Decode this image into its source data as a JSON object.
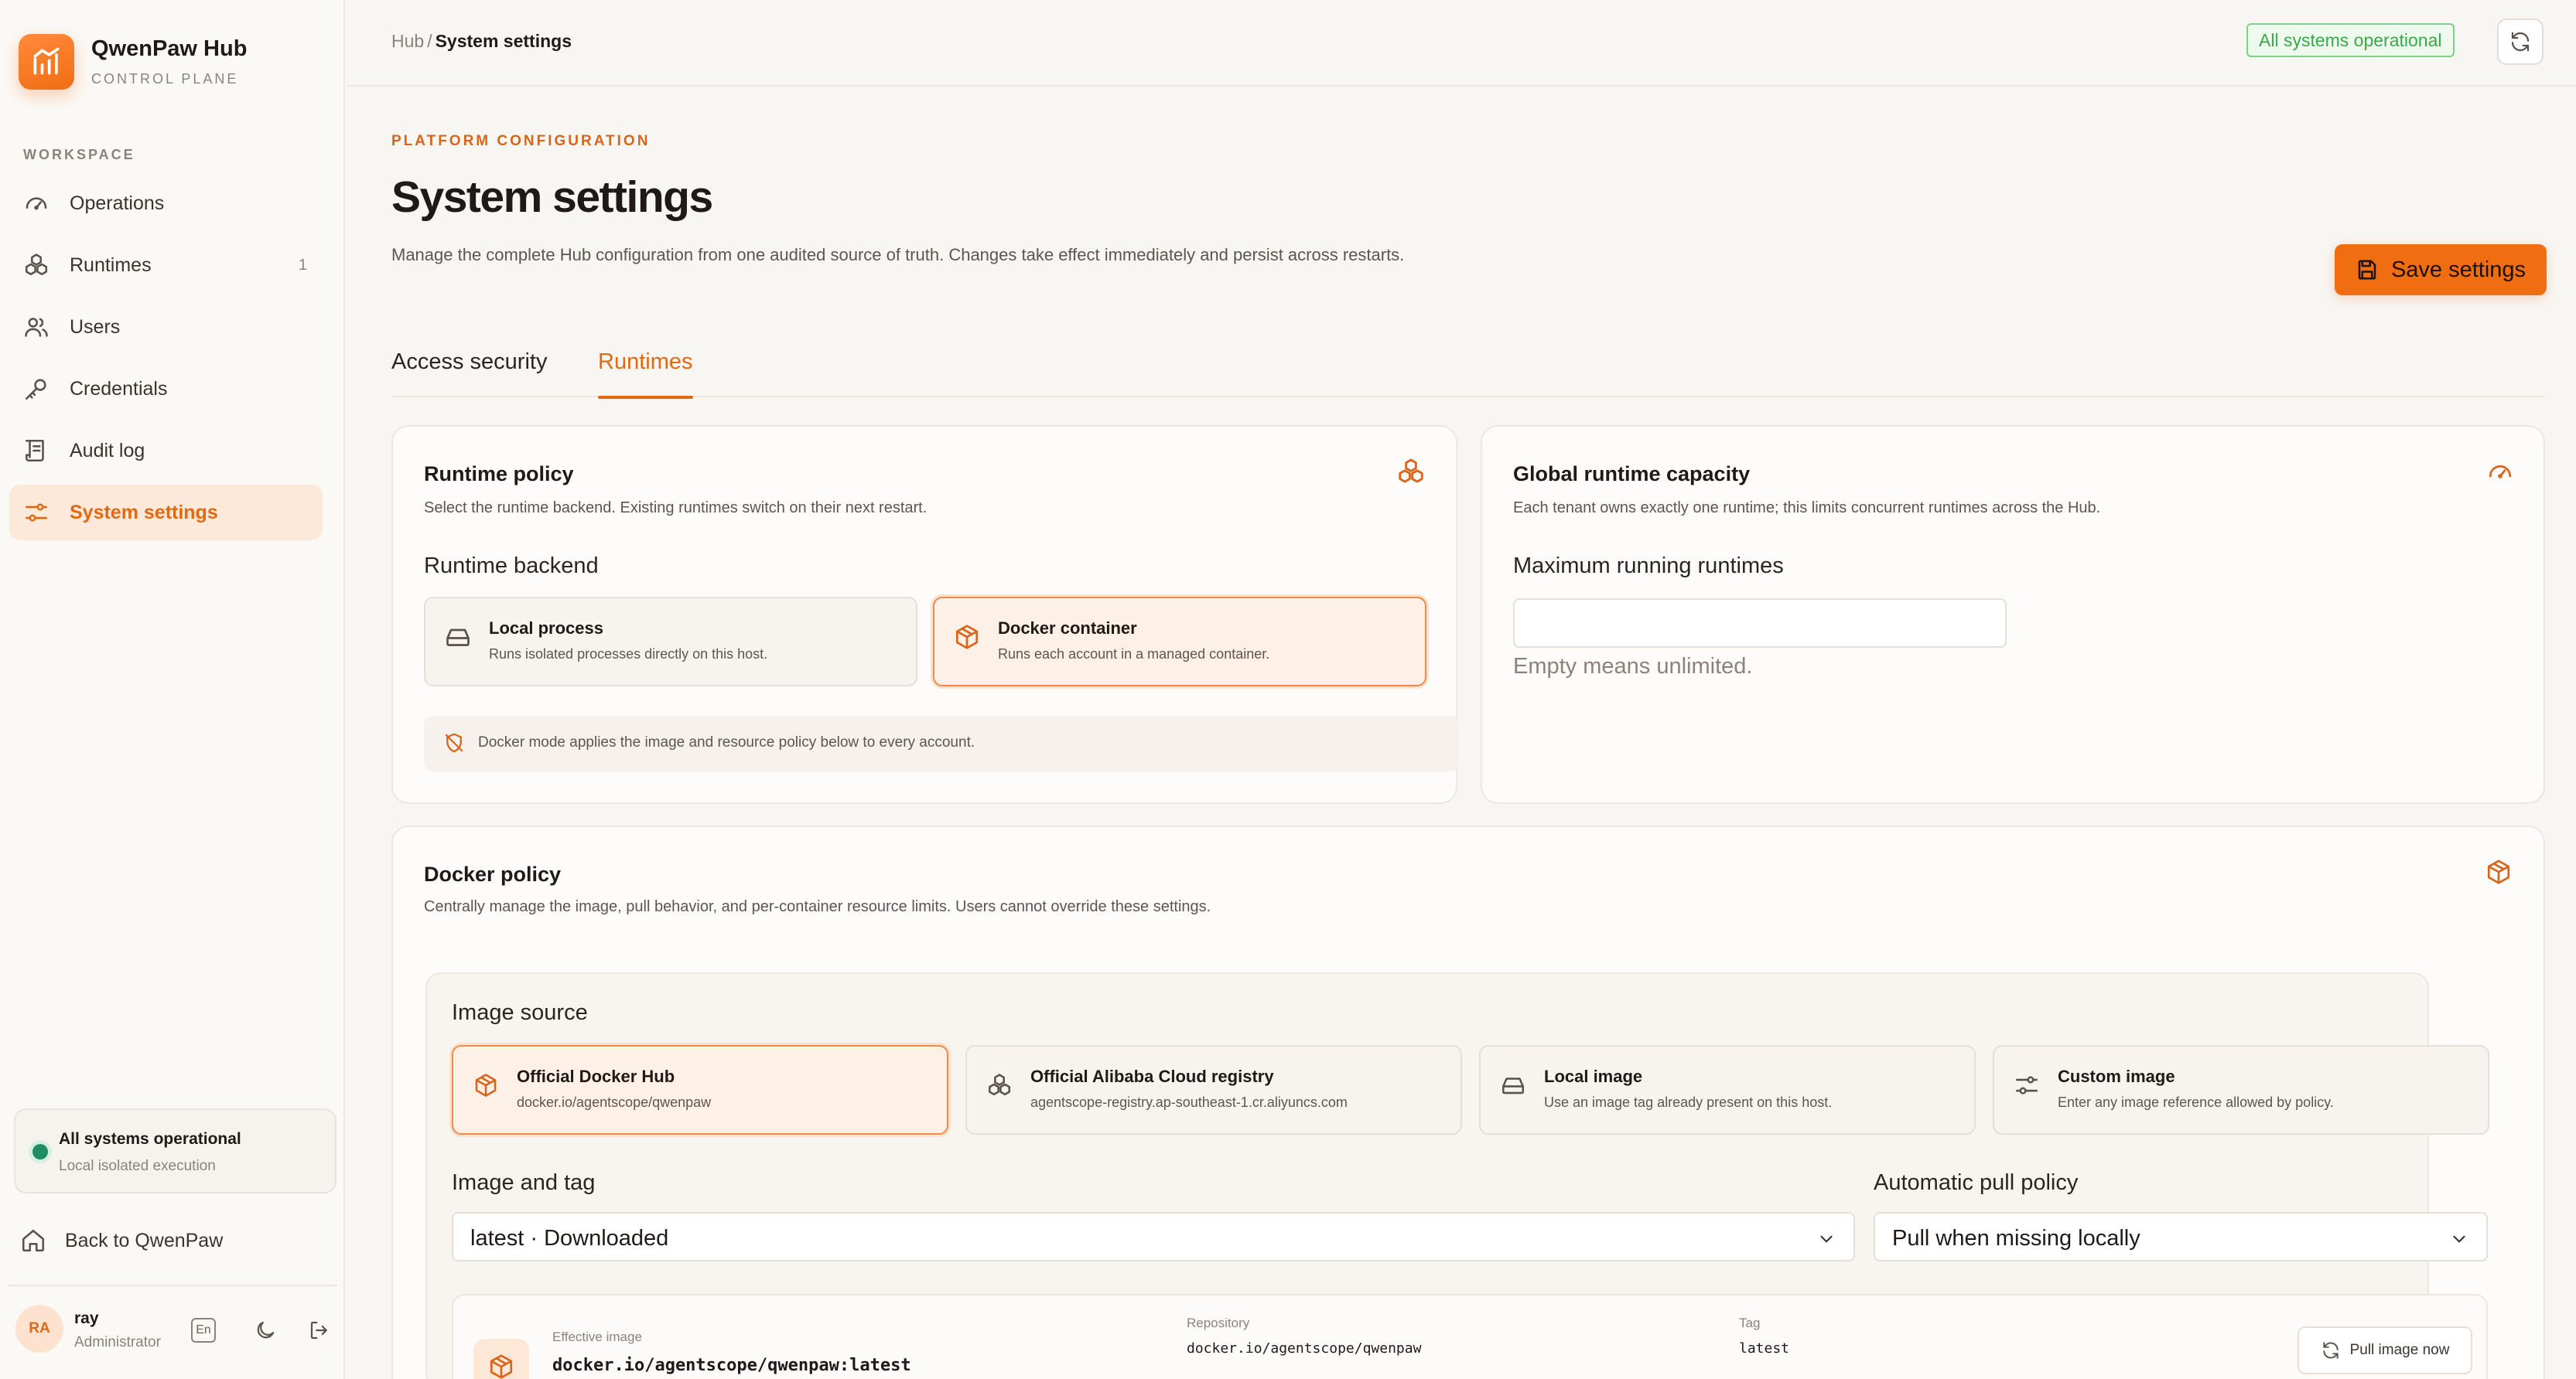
{
  "brand": {
    "title": "QwenPaw Hub",
    "subtitle": "CONTROL PLANE"
  },
  "sidebar": {
    "section_label": "WORKSPACE",
    "items": [
      {
        "label": "Operations",
        "icon": "gauge-icon"
      },
      {
        "label": "Runtimes",
        "icon": "runtimes-icon",
        "badge": "1"
      },
      {
        "label": "Users",
        "icon": "users-icon"
      },
      {
        "label": "Credentials",
        "icon": "key-icon"
      },
      {
        "label": "Audit log",
        "icon": "audit-log-icon"
      },
      {
        "label": "System settings",
        "icon": "settings-sliders-icon",
        "active": true
      }
    ],
    "status": {
      "title": "All systems operational",
      "subtitle": "Local isolated execution"
    },
    "back_label": "Back to QwenPaw",
    "user": {
      "initials": "RA",
      "name": "ray",
      "role": "Administrator",
      "lang_label": "En"
    }
  },
  "topbar": {
    "breadcrumb_root": "Hub",
    "breadcrumb_separator": "/",
    "breadcrumb_current": "System settings",
    "status_pill": "All systems operational"
  },
  "header": {
    "eyebrow": "PLATFORM CONFIGURATION",
    "title": "System settings",
    "description": "Manage the complete Hub configuration from one audited source of truth. Changes take effect immediately and persist across restarts.",
    "save_label": "Save settings"
  },
  "tabs": [
    {
      "label": "Access security",
      "active": false
    },
    {
      "label": "Runtimes",
      "active": true
    }
  ],
  "runtime_policy": {
    "title": "Runtime policy",
    "description": "Select the runtime backend. Existing runtimes switch on their next restart.",
    "backend_label": "Runtime backend",
    "options": [
      {
        "title": "Local process",
        "desc": "Runs isolated processes directly on this host.",
        "selected": false
      },
      {
        "title": "Docker container",
        "desc": "Runs each account in a managed container.",
        "selected": true
      }
    ],
    "note": "Docker mode applies the image and resource policy below to every account."
  },
  "capacity": {
    "title": "Global runtime capacity",
    "description": "Each tenant owns exactly one runtime; this limits concurrent runtimes across the Hub.",
    "field_label": "Maximum running runtimes",
    "value": "",
    "hint": "Empty means unlimited."
  },
  "docker_policy": {
    "title": "Docker policy",
    "description": "Centrally manage the image, pull behavior, and per-container resource limits. Users cannot override these settings.",
    "image_source_label": "Image source",
    "sources": [
      {
        "title": "Official Docker Hub",
        "desc": "docker.io/agentscope/qwenpaw",
        "selected": true
      },
      {
        "title": "Official Alibaba Cloud registry",
        "desc": "agentscope-registry.ap-southeast-1.cr.aliyuncs.com",
        "selected": false
      },
      {
        "title": "Local image",
        "desc": "Use an image tag already present on this host.",
        "selected": false
      },
      {
        "title": "Custom image",
        "desc": "Enter any image reference allowed by policy.",
        "selected": false
      }
    ],
    "image_tag_label": "Image and tag",
    "image_tag_value": "latest · Downloaded",
    "pull_policy_label": "Automatic pull policy",
    "pull_policy_value": "Pull when missing locally",
    "effective": {
      "label": "Effective image",
      "value": "docker.io/agentscope/qwenpaw:latest",
      "repo_label": "Repository",
      "repo_value": "docker.io/agentscope/qwenpaw",
      "tag_label": "Tag",
      "tag_value": "latest",
      "pull_label": "Pull image now"
    }
  },
  "colors": {
    "accent": "#f06d12",
    "accent_text": "#e3680f",
    "success": "#3aa84a",
    "background": "#f8f6f3"
  }
}
